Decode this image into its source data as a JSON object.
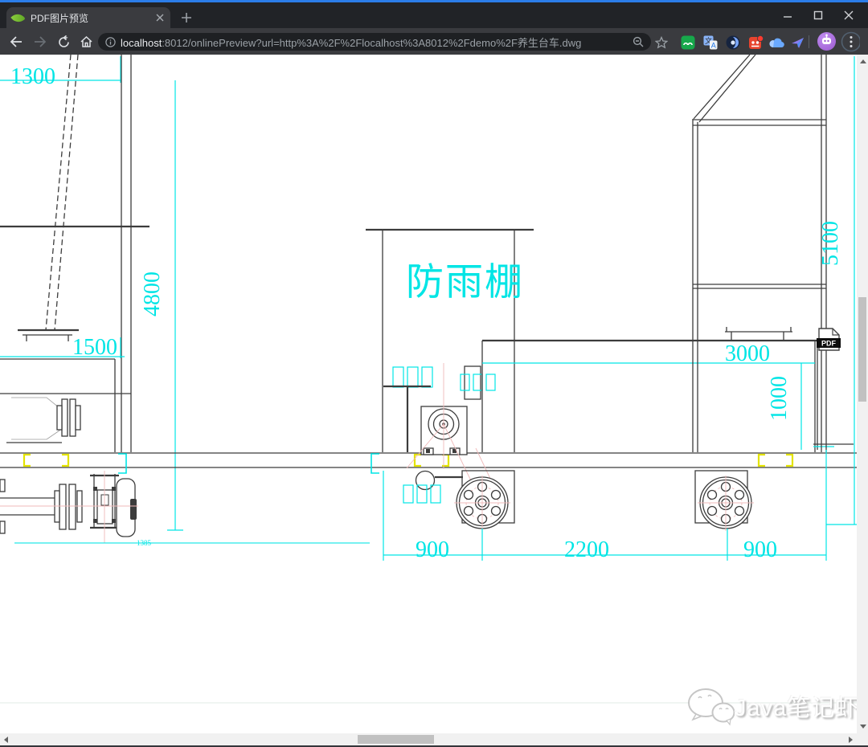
{
  "browser": {
    "tab_title": "PDF图片预览",
    "url_host": "localhost",
    "url_path": ":8012/onlinePreview?url=http%3A%2F%2Flocalhost%3A8012%2Fdemo%2F养生台车.dwg"
  },
  "drawing": {
    "dims": {
      "d1300": "1300",
      "d4800": "4800",
      "d1500": "1500",
      "d1385": "1385",
      "d3000": "3000",
      "d1000": "1000",
      "d5100": "5100",
      "d900L": "900",
      "d2200": "2200",
      "d900R": "900"
    },
    "shelter_label": "防雨棚",
    "pdf_button": "PDF"
  },
  "watermark": {
    "text": "Java笔记虾"
  },
  "colors": {
    "dimension_cyan": "#00e5e5",
    "cad_line": "#3c3c3c",
    "clamp_yellow": "#e3e300",
    "centerline_pink": "#efb9b9",
    "accent_blue": "#2b7de9"
  }
}
